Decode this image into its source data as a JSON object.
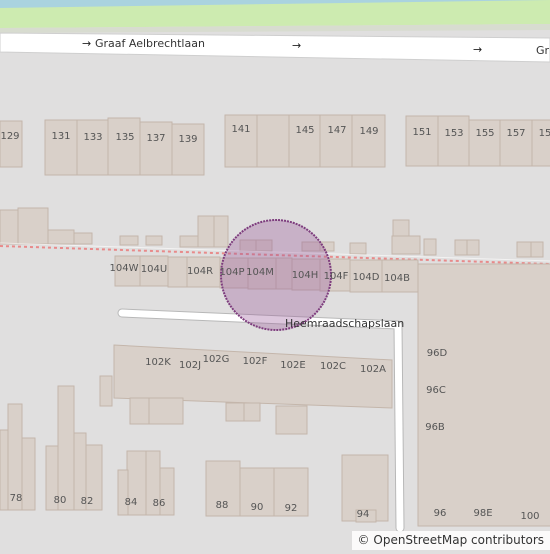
{
  "map": {
    "streets": {
      "top": "Graaf Aelbrechtlaan",
      "top_clipped": "Gr",
      "middle": "Heemraadschapslaan"
    },
    "oneway_arrow": "→",
    "house_numbers": {
      "n129": "129",
      "n131": "131",
      "n133": "133",
      "n135": "135",
      "n137": "137",
      "n139": "139",
      "n141": "141",
      "n145": "145",
      "n147": "147",
      "n149": "149",
      "n151": "151",
      "n153": "153",
      "n155": "155",
      "n157": "157",
      "n159": "15",
      "n104W": "104W",
      "n104U": "104U",
      "n104R": "104R",
      "n104P": "104P",
      "n104M": "104M",
      "n104H": "104H",
      "n104F": "104F",
      "n104D": "104D",
      "n104B": "104B",
      "n102K": "102K",
      "n102J": "102J",
      "n102G": "102G",
      "n102F": "102F",
      "n102E": "102E",
      "n102C": "102C",
      "n102A": "102A",
      "n96D": "96D",
      "n96C": "96C",
      "n96B": "96B",
      "n96": "96",
      "n98E": "98E",
      "n100": "100",
      "n78": "78",
      "n80": "80",
      "n82": "82",
      "n84": "84",
      "n86": "86",
      "n88": "88",
      "n90": "90",
      "n92": "92",
      "n94": "94"
    },
    "colors": {
      "background": "#e0dfdf",
      "building": "#d9d0c9",
      "building_stroke": "#c4b6ab",
      "road": "#ffffff",
      "rail_dash": "#e88a8a",
      "water": "#aad3df",
      "grass": "#cdebb0",
      "marker_fill": "#9c5b9a",
      "marker_stroke": "#7d3c7d"
    }
  },
  "attribution": {
    "copyright": "©",
    "text": "OpenStreetMap contributors"
  }
}
